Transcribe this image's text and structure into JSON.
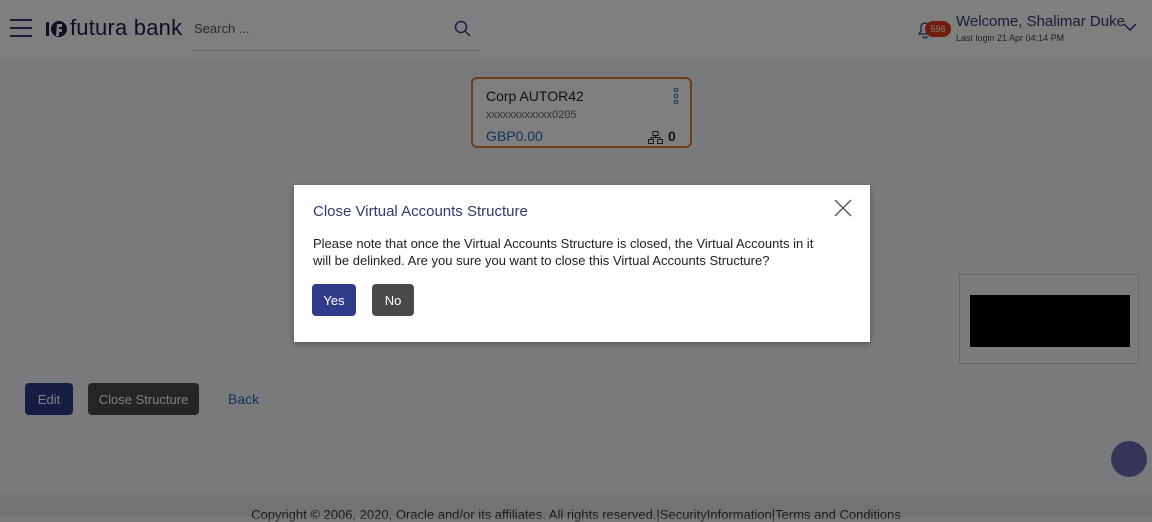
{
  "header": {
    "brand": "futura bank",
    "search_placeholder": "Search ...",
    "notification_count": "596",
    "welcome": "Welcome, Shalimar Duke",
    "last_login": "Last login 21 Apr 04:14 PM"
  },
  "card": {
    "name": "Corp AUTOR42",
    "account_number": "xxxxxxxxxxxx0205",
    "balance": "GBP0.00",
    "children_count": "0"
  },
  "actions": {
    "edit_label": "Edit",
    "close_structure_label": "Close Structure",
    "back_label": "Back"
  },
  "footer": {
    "text": "Copyright © 2006, 2020, Oracle and/or its affiliates. All rights reserved.|SecurityInformation|Terms and Conditions"
  },
  "modal": {
    "title": "Close Virtual Accounts Structure",
    "body_line1": "Please note that once the Virtual Accounts Structure is closed, the Virtual Accounts in it",
    "body_line2": "will be delinked. Are you sure you want to close this Virtual Accounts Structure?",
    "yes_label": "Yes",
    "no_label": "No"
  },
  "colors": {
    "brand_primary": "#303b8a",
    "accent_orange": "#e07a2f",
    "link_blue": "#2a62b5",
    "badge_red": "#e03a17"
  },
  "icons": [
    "hamburger-menu-icon",
    "futura-logo-icon",
    "search-icon",
    "bell-icon",
    "chevron-down-icon",
    "kebab-menu-icon",
    "hierarchy-icon",
    "close-icon",
    "scroll-top-icon"
  ]
}
